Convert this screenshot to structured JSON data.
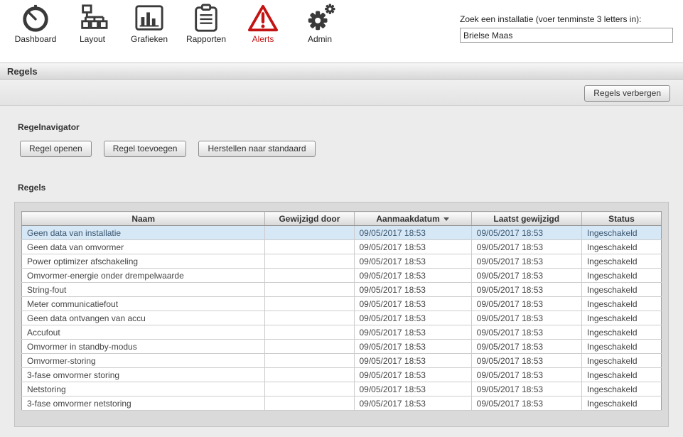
{
  "nav": {
    "items": [
      {
        "label": "Dashboard"
      },
      {
        "label": "Layout"
      },
      {
        "label": "Grafieken"
      },
      {
        "label": "Rapporten"
      },
      {
        "label": "Alerts"
      },
      {
        "label": "Admin"
      }
    ],
    "icon_color": "#3a3a3a",
    "alert_color": "#c41313"
  },
  "search": {
    "label": "Zoek een installatie (voer tenminste 3 letters in):",
    "value": "Brielse Maas"
  },
  "panel": {
    "title": "Regels",
    "hide_button_label": "Regels verbergen",
    "navigator_title": "Regelnavigator",
    "actions": {
      "open_label": "Regel openen",
      "add_label": "Regel toevoegen",
      "restore_label": "Herstellen naar standaard"
    },
    "table_title": "Regels",
    "table": {
      "columns": [
        "Naam",
        "Gewijzigd door",
        "Aanmaakdatum",
        "Laatst gewijzigd",
        "Status"
      ],
      "sort_column": "Aanmaakdatum",
      "sort_direction": "desc",
      "selected_row": 0,
      "rows": [
        [
          "Geen data van installatie",
          "",
          "09/05/2017 18:53",
          "09/05/2017 18:53",
          "Ingeschakeld"
        ],
        [
          "Geen data van omvormer",
          "",
          "09/05/2017 18:53",
          "09/05/2017 18:53",
          "Ingeschakeld"
        ],
        [
          "Power optimizer afschakeling",
          "",
          "09/05/2017 18:53",
          "09/05/2017 18:53",
          "Ingeschakeld"
        ],
        [
          "Omvormer-energie onder drempelwaarde",
          "",
          "09/05/2017 18:53",
          "09/05/2017 18:53",
          "Ingeschakeld"
        ],
        [
          "String-fout",
          "",
          "09/05/2017 18:53",
          "09/05/2017 18:53",
          "Ingeschakeld"
        ],
        [
          "Meter communicatiefout",
          "",
          "09/05/2017 18:53",
          "09/05/2017 18:53",
          "Ingeschakeld"
        ],
        [
          "Geen data ontvangen van accu",
          "",
          "09/05/2017 18:53",
          "09/05/2017 18:53",
          "Ingeschakeld"
        ],
        [
          "Accufout",
          "",
          "09/05/2017 18:53",
          "09/05/2017 18:53",
          "Ingeschakeld"
        ],
        [
          "Omvormer in standby-modus",
          "",
          "09/05/2017 18:53",
          "09/05/2017 18:53",
          "Ingeschakeld"
        ],
        [
          "Omvormer-storing",
          "",
          "09/05/2017 18:53",
          "09/05/2017 18:53",
          "Ingeschakeld"
        ],
        [
          "3-fase omvormer storing",
          "",
          "09/05/2017 18:53",
          "09/05/2017 18:53",
          "Ingeschakeld"
        ],
        [
          "Netstoring",
          "",
          "09/05/2017 18:53",
          "09/05/2017 18:53",
          "Ingeschakeld"
        ],
        [
          "3-fase omvormer netstoring",
          "",
          "09/05/2017 18:53",
          "09/05/2017 18:53",
          "Ingeschakeld"
        ]
      ]
    }
  }
}
